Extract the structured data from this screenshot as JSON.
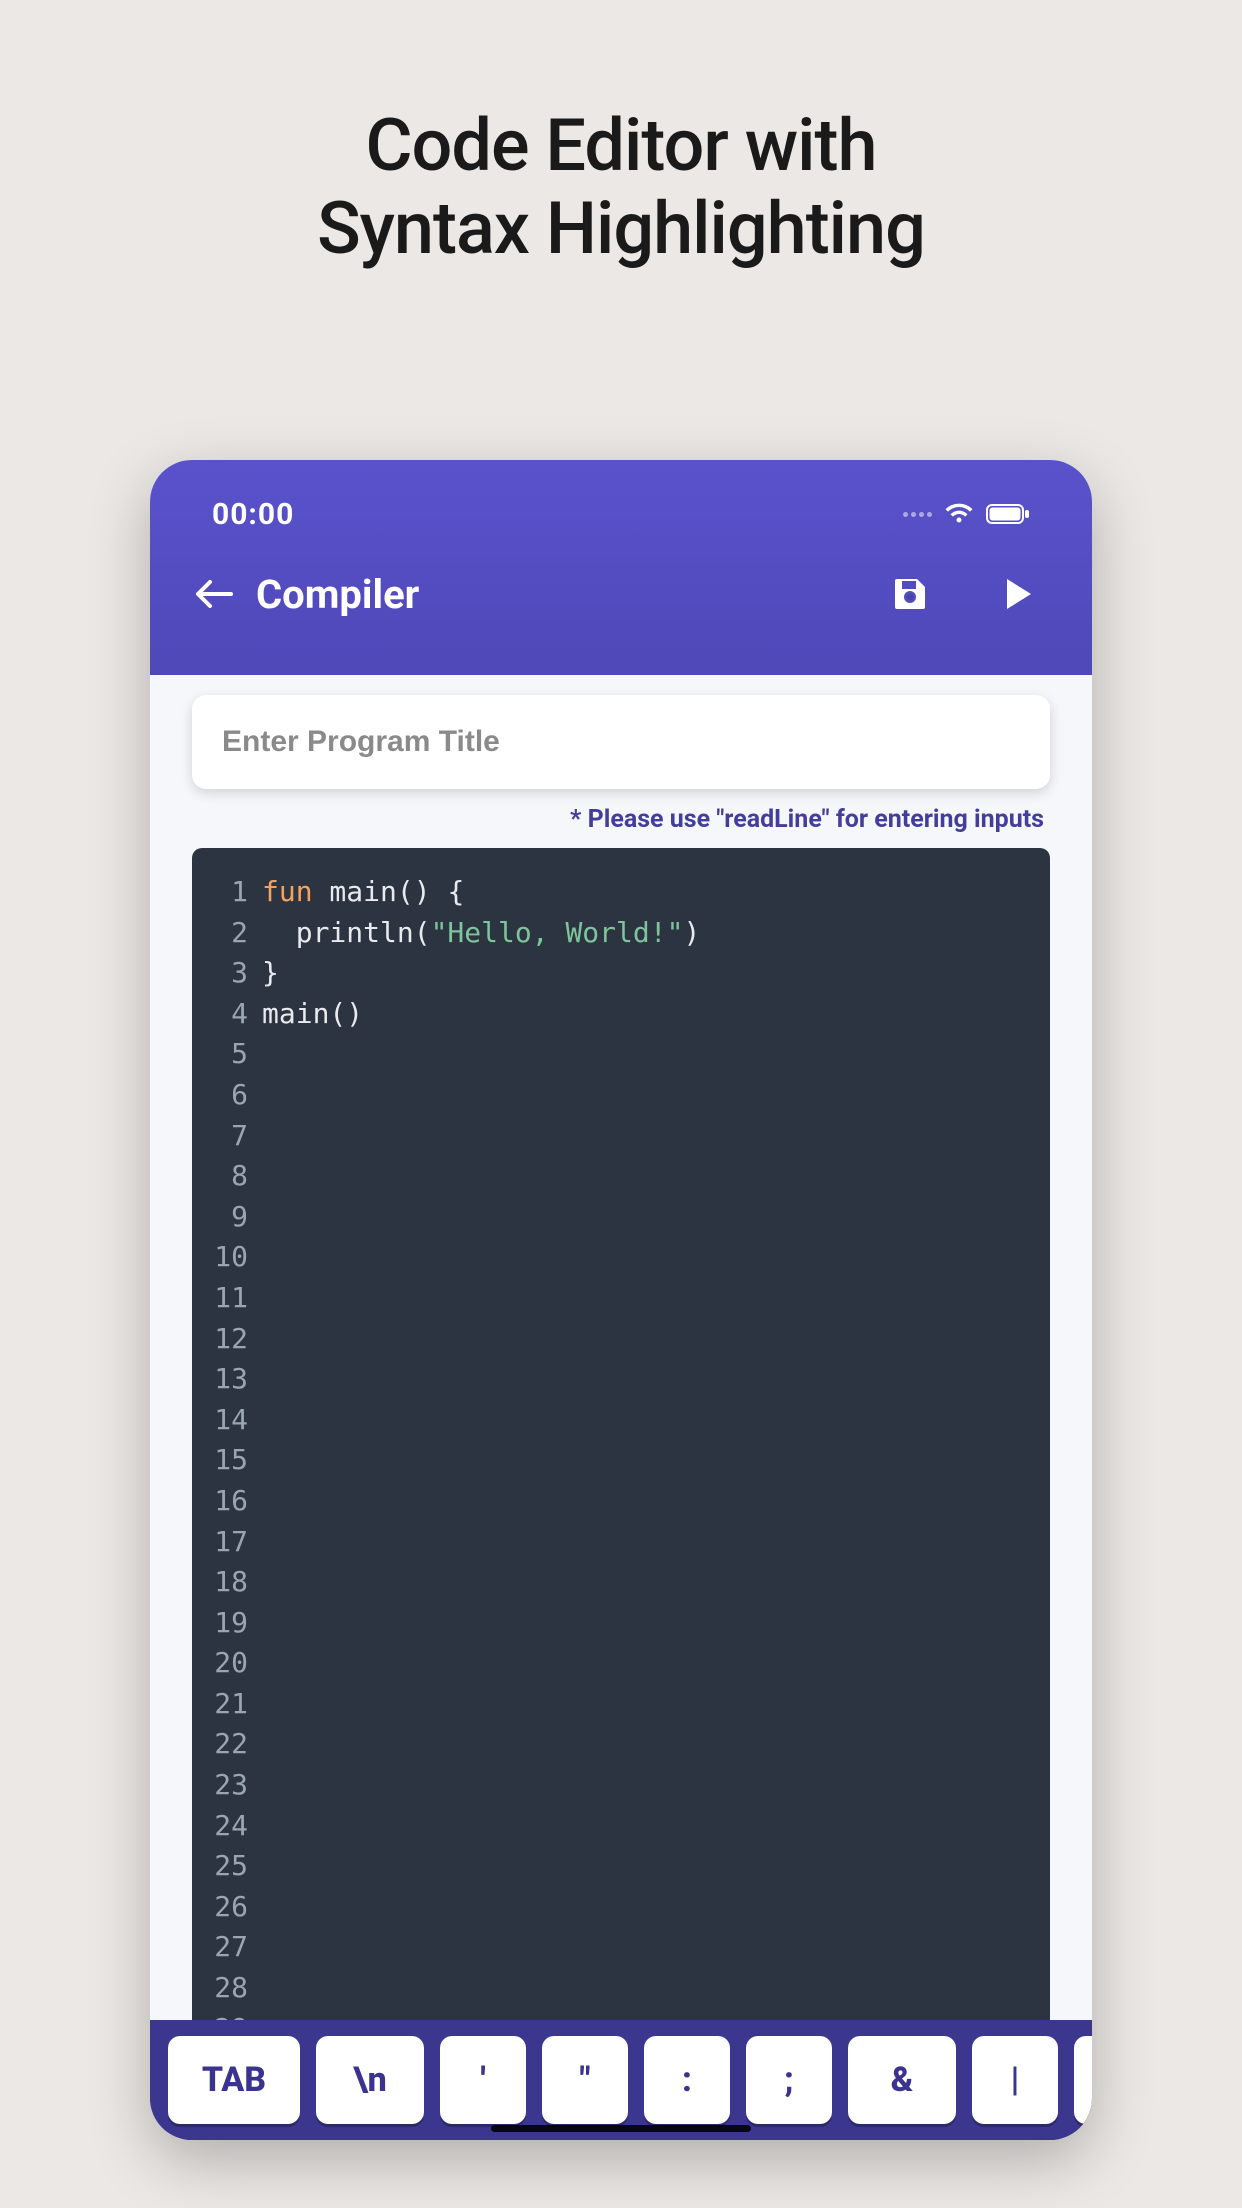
{
  "promo": {
    "line1": "Code Editor with",
    "line2": "Syntax Highlighting"
  },
  "status": {
    "time": "00:00"
  },
  "appbar": {
    "title": "Compiler"
  },
  "inputs": {
    "title_placeholder": "Enter Program Title"
  },
  "hint": "* Please use \"readLine\" for entering inputs",
  "code": {
    "max_lines": 29,
    "lines": [
      [
        {
          "t": "fun",
          "c": "keyword"
        },
        {
          "t": " main() {",
          "c": "plain"
        }
      ],
      [
        {
          "t": "  println(",
          "c": "plain"
        },
        {
          "t": "\"Hello, World!\"",
          "c": "string"
        },
        {
          "t": ")",
          "c": "plain"
        }
      ],
      [
        {
          "t": "}",
          "c": "plain"
        }
      ],
      [
        {
          "t": "main()",
          "c": "plain"
        }
      ]
    ]
  },
  "keyboard": [
    {
      "label": "TAB",
      "size": "wide"
    },
    {
      "label": "\\n",
      "size": "med"
    },
    {
      "label": "'",
      "size": "narrow"
    },
    {
      "label": "\"",
      "size": "narrow"
    },
    {
      "label": ":",
      "size": "narrow"
    },
    {
      "label": ";",
      "size": "narrow"
    },
    {
      "label": "&",
      "size": "med"
    },
    {
      "label": "|",
      "size": "narrow"
    }
  ]
}
